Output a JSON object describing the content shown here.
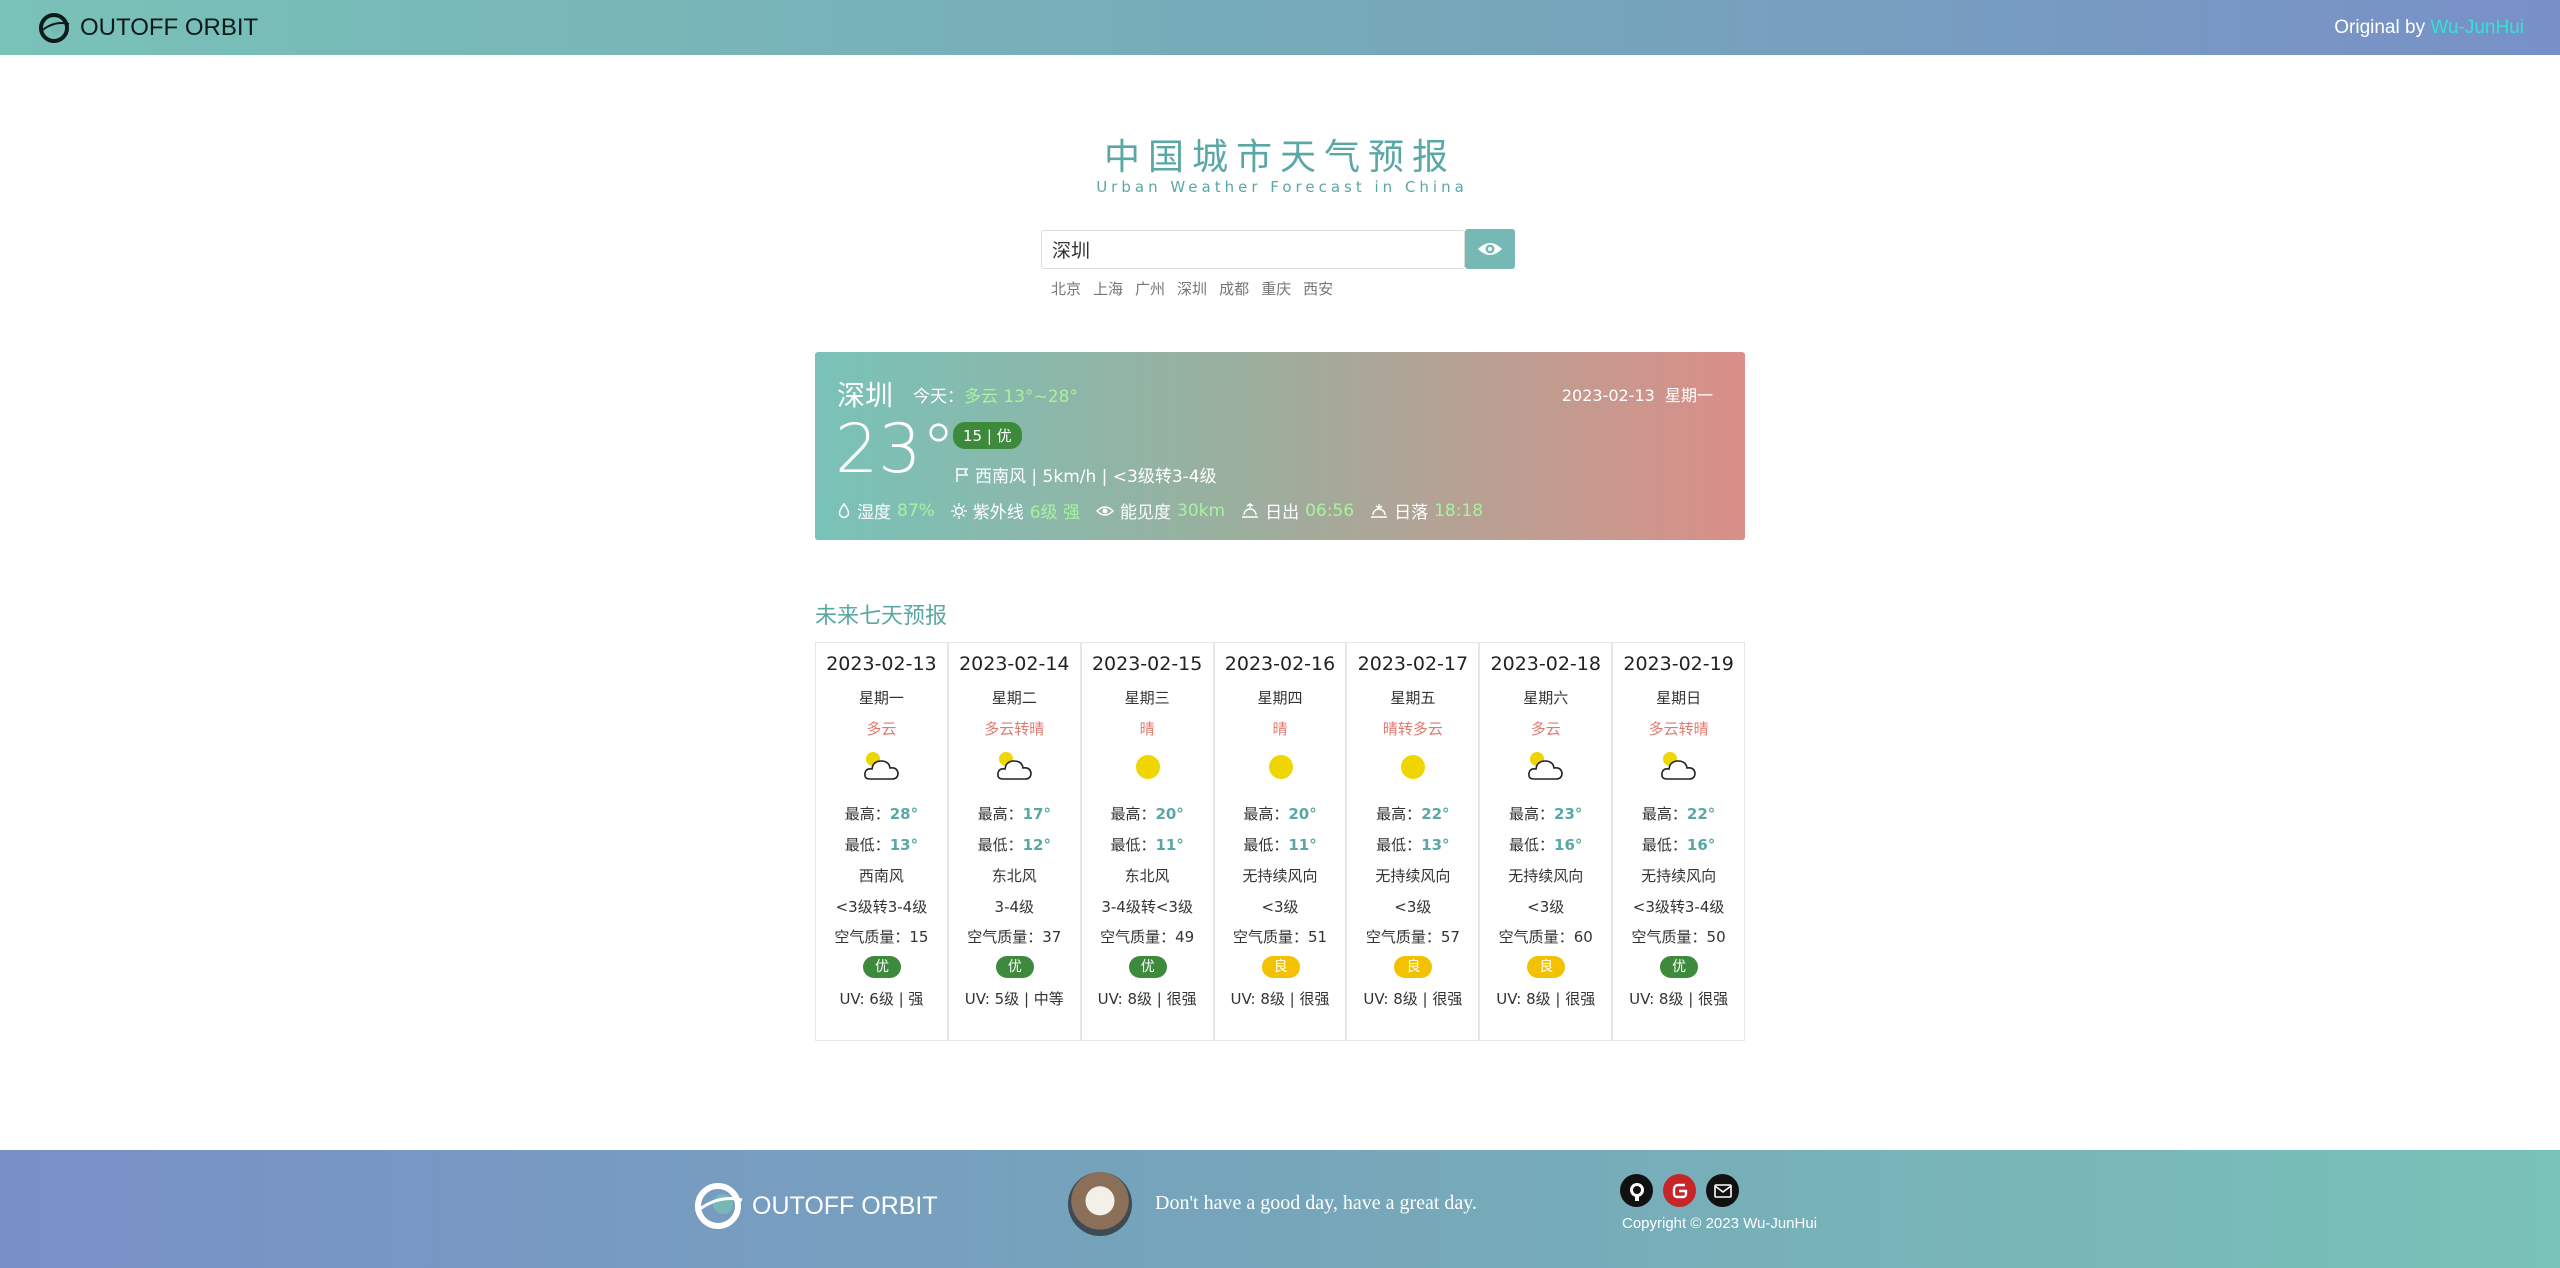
{
  "nav": {
    "brand": "OUTOFF ORBIT",
    "original_prefix": "Original by ",
    "original_author": "Wu-JunHui"
  },
  "header": {
    "title": "中国城市天气预报",
    "subtitle": "Urban Weather Forecast in China"
  },
  "search": {
    "value": "深圳",
    "button_icon": "eye-icon",
    "quick_cities": [
      "北京",
      "上海",
      "广州",
      "深圳",
      "成都",
      "重庆",
      "西安"
    ]
  },
  "current": {
    "city": "深圳",
    "today_label": "今天：",
    "today_value": "多云 13°~28°",
    "date": "2023-02-13",
    "weekday": "星期一",
    "temp": "23°",
    "aqi_badge": "15 | 优",
    "wind": "西南风 | 5km/h | <3级转3-4级",
    "humidity_label": "湿度",
    "humidity": "87%",
    "uv_label": "紫外线",
    "uv": "6级 强",
    "visibility_label": "能见度",
    "visibility": "30km",
    "sunrise_label": "日出",
    "sunrise": "06:56",
    "sunset_label": "日落",
    "sunset": "18:18"
  },
  "forecast_title": "未来七天预报",
  "labels": {
    "high": "最高：",
    "low": "最低：",
    "aqi": "空气质量："
  },
  "forecast": [
    {
      "date": "2023-02-13",
      "weekday": "星期一",
      "cond": "多云",
      "icon": "partly-cloudy-icon",
      "high": "28°",
      "low": "13°",
      "wind_dir": "西南风",
      "wind_level": "<3级转3-4级",
      "aqi": "15",
      "level": "优",
      "level_color": "#3d8a3c",
      "uv": "UV: 6级 | 强"
    },
    {
      "date": "2023-02-14",
      "weekday": "星期二",
      "cond": "多云转晴",
      "icon": "partly-cloudy-icon",
      "high": "17°",
      "low": "12°",
      "wind_dir": "东北风",
      "wind_level": "3-4级",
      "aqi": "37",
      "level": "优",
      "level_color": "#3d8a3c",
      "uv": "UV: 5级 | 中等"
    },
    {
      "date": "2023-02-15",
      "weekday": "星期三",
      "cond": "晴",
      "icon": "sun-icon",
      "high": "20°",
      "low": "11°",
      "wind_dir": "东北风",
      "wind_level": "3-4级转<3级",
      "aqi": "49",
      "level": "优",
      "level_color": "#3d8a3c",
      "uv": "UV: 8级 | 很强"
    },
    {
      "date": "2023-02-16",
      "weekday": "星期四",
      "cond": "晴",
      "icon": "sun-icon",
      "high": "20°",
      "low": "11°",
      "wind_dir": "无持续风向",
      "wind_level": "<3级",
      "aqi": "51",
      "level": "良",
      "level_color": "#f2c200",
      "uv": "UV: 8级 | 很强"
    },
    {
      "date": "2023-02-17",
      "weekday": "星期五",
      "cond": "晴转多云",
      "icon": "sun-icon",
      "high": "22°",
      "low": "13°",
      "wind_dir": "无持续风向",
      "wind_level": "<3级",
      "aqi": "57",
      "level": "良",
      "level_color": "#f2c200",
      "uv": "UV: 8级 | 很强"
    },
    {
      "date": "2023-02-18",
      "weekday": "星期六",
      "cond": "多云",
      "icon": "partly-cloudy-icon",
      "high": "23°",
      "low": "16°",
      "wind_dir": "无持续风向",
      "wind_level": "<3级",
      "aqi": "60",
      "level": "良",
      "level_color": "#f2c200",
      "uv": "UV: 8级 | 很强"
    },
    {
      "date": "2023-02-19",
      "weekday": "星期日",
      "cond": "多云转晴",
      "icon": "partly-cloudy-icon",
      "high": "22°",
      "low": "16°",
      "wind_dir": "无持续风向",
      "wind_level": "<3级转3-4级",
      "aqi": "50",
      "level": "优",
      "level_color": "#3d8a3c",
      "uv": "UV: 8级 | 很强"
    }
  ],
  "footer": {
    "brand": "OUTOFF ORBIT",
    "motto": "Don't have a good day, have a great day.",
    "copyright": "Copyright © 2023 Wu-JunHui",
    "icons": [
      "github-icon",
      "gitee-icon",
      "mail-icon"
    ]
  }
}
